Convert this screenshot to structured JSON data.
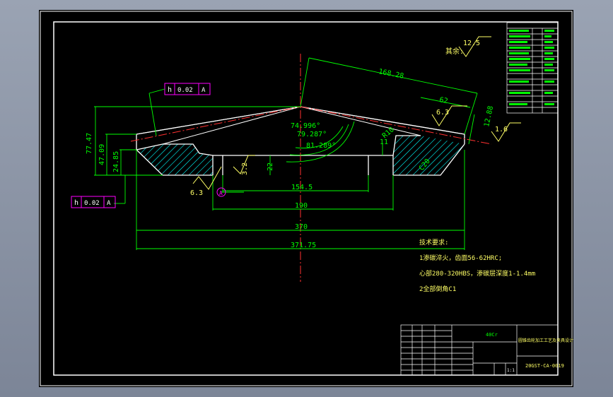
{
  "colors": {
    "background": "#000000",
    "frame": "#ffffff",
    "dimension": "#00ff00",
    "centerline": "#ff3030",
    "tolerance": "#ff00ff",
    "hatch": "#00ffff",
    "outline": "#ffffff",
    "text": "#ffff66"
  },
  "dimensions": {
    "d_168": "168.28",
    "d_62": "62",
    "d_1288": "12.88",
    "d_7747": "77.47",
    "d_4709": "47.09",
    "d_2485": "24.85",
    "d_22": "22",
    "d_1545": "154.5",
    "d_190": "190",
    "d_370": "370",
    "d_37175": "371.75",
    "d_11": "11",
    "d_r10": "R10",
    "d_c20": "C20"
  },
  "angles": {
    "a1": "74.996°",
    "a2": "79.287°",
    "a3": "81.289°"
  },
  "roughness": {
    "r_125": "12.5",
    "r_63_top": "6.3",
    "r_63_left": "6.3",
    "r_16": "1.6",
    "r_32": "3.2",
    "rest_label": "其余:"
  },
  "tolerance": {
    "symbol": "h",
    "value": "0.02",
    "datum": "A"
  },
  "datum_label": "A",
  "notes": {
    "title": "技术要求:",
    "line1": "1渗碳淬火，齿面56-62HRC;",
    "line2": "心部280-320HBS，渗碳层深度1-1.4mm",
    "line3": "2全部倒角C1"
  },
  "title_block": {
    "material": "40Cr",
    "part_name": "圆锥齿轮加工工艺及夹具设计",
    "drawing_no": "20GST-CA-0019",
    "scale": "1:1"
  }
}
